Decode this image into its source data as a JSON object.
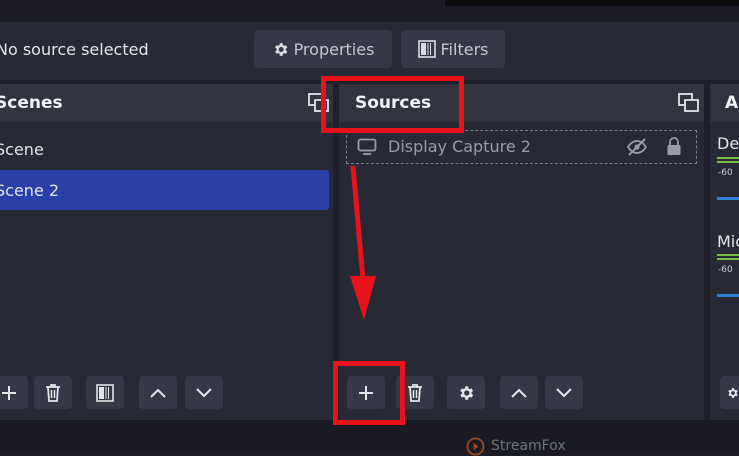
{
  "context_bar": {
    "status_text": "No source selected",
    "properties_label": "Properties",
    "filters_label": "Filters"
  },
  "scenes_panel": {
    "title": "Scenes",
    "items": [
      "Scene",
      "Scene 2"
    ],
    "selected_index": 1
  },
  "sources_panel": {
    "title": "Sources",
    "items": [
      {
        "name": "Display Capture 2",
        "hidden": true,
        "locked": true
      }
    ]
  },
  "audio_panel": {
    "title": "A",
    "channels": [
      {
        "name": "De",
        "scale": "-60"
      },
      {
        "name": "Mic",
        "scale": "-60"
      }
    ]
  },
  "watermark": {
    "text": "StreamFox"
  },
  "colors": {
    "selection": "#2b3fa8",
    "annotation": "#e8131a",
    "meter_green": "#6fbf3b",
    "slider_blue": "#2e7fd8"
  },
  "icons": [
    "gear-icon",
    "filter-icon",
    "dock-icon",
    "monitor-icon",
    "eye-slash-icon",
    "lock-icon",
    "plus-icon",
    "trash-icon",
    "chevron-up-icon",
    "chevron-down-icon",
    "streamfox-logo-icon"
  ]
}
